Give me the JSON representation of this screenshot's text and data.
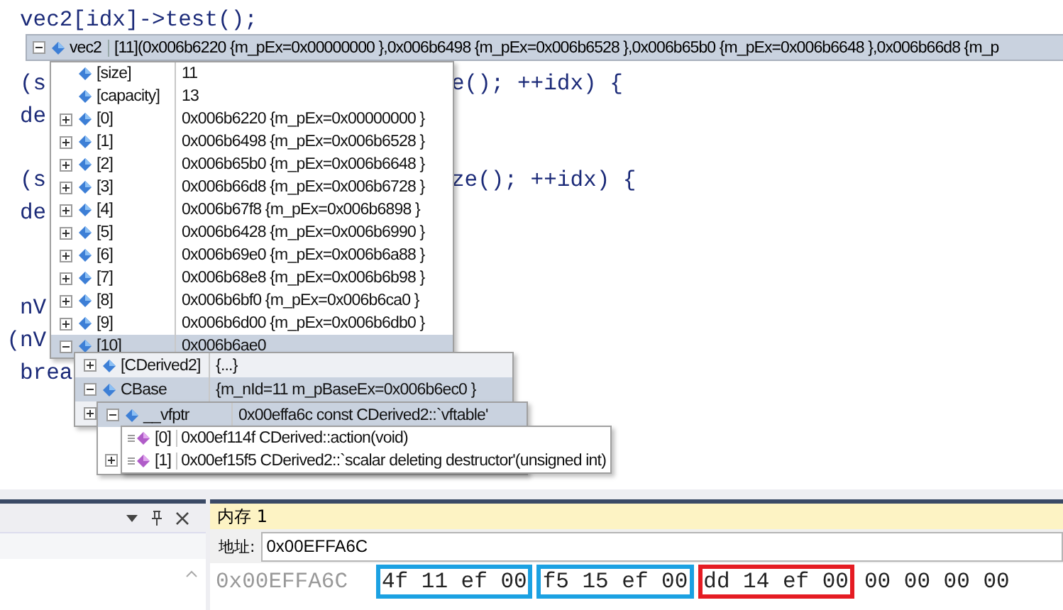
{
  "code_lines": [
    {
      "kind": "code",
      "left": "  vec2[idx]->test();"
    },
    {
      "kind": "gap"
    },
    {
      "kind": "code",
      "left": "  (s",
      "right": "e(); ++idx) {"
    },
    {
      "kind": "code",
      "left": "  de"
    },
    {
      "kind": "gap"
    },
    {
      "kind": "code",
      "left": "  (s",
      "right": "ze(); ++idx) {"
    },
    {
      "kind": "code",
      "left": "  de"
    },
    {
      "kind": "gap"
    },
    {
      "kind": "gap"
    },
    {
      "kind": "code",
      "left": "  nV"
    },
    {
      "kind": "code",
      "left": " (nV"
    },
    {
      "kind": "code",
      "left": "  brea"
    }
  ],
  "datatip": {
    "header": {
      "name": "vec2",
      "value": "[11](0x006b6220 {m_pEx=0x00000000 },0x006b6498 {m_pEx=0x006b6528 },0x006b65b0 {m_pEx=0x006b6648 },0x006b66d8 {m_p",
      "expanded": true
    },
    "items": [
      {
        "kind": "leaf",
        "name": "[size]",
        "value": "11",
        "selected": false
      },
      {
        "kind": "leaf",
        "name": "[capacity]",
        "value": "13",
        "selected": false
      },
      {
        "kind": "node",
        "expanded": false,
        "name": "[0]",
        "value": "0x006b6220 {m_pEx=0x00000000 }",
        "selected": false
      },
      {
        "kind": "node",
        "expanded": false,
        "name": "[1]",
        "value": "0x006b6498 {m_pEx=0x006b6528 }",
        "selected": false
      },
      {
        "kind": "node",
        "expanded": false,
        "name": "[2]",
        "value": "0x006b65b0 {m_pEx=0x006b6648 }",
        "selected": false
      },
      {
        "kind": "node",
        "expanded": false,
        "name": "[3]",
        "value": "0x006b66d8 {m_pEx=0x006b6728 }",
        "selected": false
      },
      {
        "kind": "node",
        "expanded": false,
        "name": "[4]",
        "value": "0x006b67f8 {m_pEx=0x006b6898 }",
        "selected": false
      },
      {
        "kind": "node",
        "expanded": false,
        "name": "[5]",
        "value": "0x006b6428 {m_pEx=0x006b6990 }",
        "selected": false
      },
      {
        "kind": "node",
        "expanded": false,
        "name": "[6]",
        "value": "0x006b69e0 {m_pEx=0x006b6a88 }",
        "selected": false
      },
      {
        "kind": "node",
        "expanded": false,
        "name": "[7]",
        "value": "0x006b68e8 {m_pEx=0x006b6b98 }",
        "selected": false
      },
      {
        "kind": "node",
        "expanded": false,
        "name": "[8]",
        "value": "0x006b6bf0 {m_pEx=0x006b6ca0 }",
        "selected": false
      },
      {
        "kind": "node",
        "expanded": false,
        "name": "[9]",
        "value": "0x006b6d00 {m_pEx=0x006b6db0 }",
        "selected": false
      },
      {
        "kind": "node",
        "expanded": true,
        "name": "[10]",
        "value": "0x006b6ae0",
        "selected": true
      }
    ]
  },
  "subtip": {
    "items": [
      {
        "kind": "node",
        "expanded": false,
        "name": "[CDerived2]",
        "value": "{...}",
        "selected": false
      },
      {
        "kind": "node",
        "expanded": true,
        "name": "CBase",
        "value": "{m_nId=11 m_pBaseEx=0x006b6ec0 }",
        "selected": true
      },
      {
        "kind": "node",
        "expanded": false
      }
    ]
  },
  "vfptr_tip": {
    "items": [
      {
        "kind": "node",
        "expanded": true,
        "name": "__vfptr",
        "value": "0x00effa6c const CDerived2::`vftable'",
        "selected": true
      }
    ]
  },
  "vtable_tip": {
    "items": [
      {
        "kind": "leaf",
        "name": "[0]",
        "value": "0x00ef114f CDerived::action(void)"
      },
      {
        "kind": "node",
        "expanded": false,
        "name": "[1]",
        "value": "0x00ef15f5 CDerived2::`scalar deleting destructor'(unsigned int)"
      }
    ]
  },
  "memory_window": {
    "tab": "内存 1",
    "address_label": "地址:",
    "address": "0x00EFFA6C",
    "row": {
      "address": "0x00EFFA6C",
      "groups": [
        {
          "bytes": "4f 11 ef 00",
          "color": "#1ba1e2"
        },
        {
          "bytes": "f5 15 ef 00",
          "color": "#1ba1e2"
        },
        {
          "bytes": "dd 14 ef 00",
          "color": "#e51c23"
        },
        {
          "bytes": "00 00 00 00"
        }
      ]
    }
  }
}
